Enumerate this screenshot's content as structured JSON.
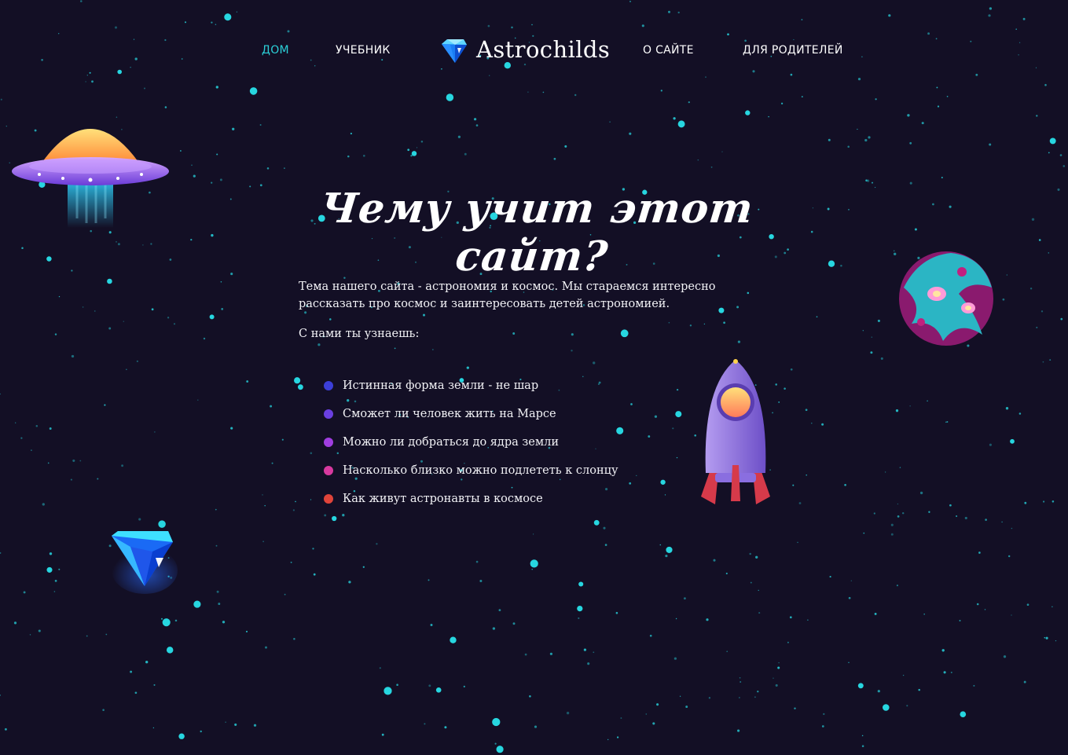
{
  "nav": {
    "left": [
      {
        "label": "ДОМ",
        "active": true
      },
      {
        "label": "УЧЕБНИК",
        "active": false
      }
    ],
    "logo_text": "Astrochilds",
    "right": [
      {
        "label": "О САЙТЕ",
        "active": false
      },
      {
        "label": "ДЛЯ РОДИТЕЛЕЙ",
        "active": false
      }
    ]
  },
  "hero": {
    "title": "Чему учит этот сайт?",
    "intro": "Тема нашего сайта - астрономия и космос. Мы стараемся интересно рассказать про космос и заинтересовать детей астрономией.",
    "subheading": "С нами ты узнаешь:",
    "topics": [
      {
        "text": "Истинная форма земли - не шар",
        "dot_color": "#3c3fd8"
      },
      {
        "text": "Сможет ли человек жить на Марсе",
        "dot_color": "#6a3fe0"
      },
      {
        "text": "Можно ли добраться до ядра земли",
        "dot_color": "#a03ee0"
      },
      {
        "text": "Насколько близко можно подлететь к слонцу",
        "dot_color": "#d8399f"
      },
      {
        "text": "Как живут астронавты в космосе",
        "dot_color": "#e0443a"
      }
    ]
  },
  "decorations": [
    "ufo-illustration",
    "alien-planet-illustration",
    "rocket-illustration",
    "crystal-gem-illustration"
  ],
  "colors": {
    "background": "#130f25",
    "accent": "#2bd0d8",
    "star": "#27d6e0",
    "text": "#ffffff"
  }
}
